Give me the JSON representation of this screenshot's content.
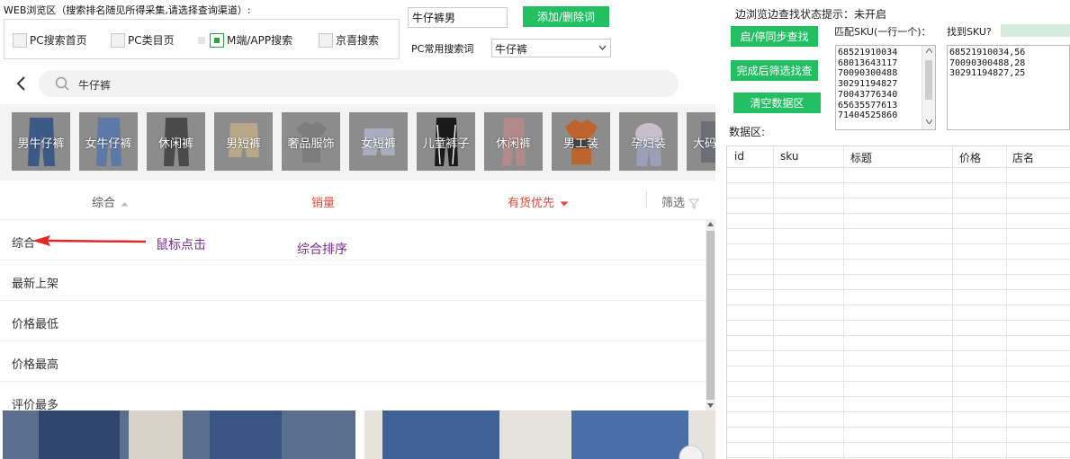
{
  "channel": {
    "title": "WEB浏览区（搜索排名随见所得采集,请选择查询渠道）:",
    "options": [
      {
        "label": "PC搜索首页",
        "checked": false
      },
      {
        "label": "PC类目页",
        "checked": false
      },
      {
        "label": "M端/APP搜索",
        "checked": true
      },
      {
        "label": "京喜搜索",
        "checked": false
      }
    ]
  },
  "keyword": {
    "value": "牛仔裤男",
    "add_button": "添加/删除词",
    "common_label": "PC常用搜索词",
    "common_selected": "牛仔裤"
  },
  "browser": {
    "search_text": "牛仔裤",
    "categories": [
      "男牛仔裤",
      "女牛仔裤",
      "休闲裤",
      "男短裤",
      "奢品服饰",
      "女短裤",
      "儿童裤子",
      "休闲裤",
      "男工装",
      "孕妇装",
      "大码"
    ],
    "sort_tabs": {
      "comprehensive": "综合",
      "sales": "销量",
      "in_stock": "有货优先",
      "filter": "筛选"
    },
    "sort_options": [
      "综合",
      "最新上架",
      "价格最低",
      "价格最高",
      "评价最多"
    ],
    "annotations": {
      "mouse_click": "鼠标点击",
      "sort_label": "综合排序"
    }
  },
  "right_panel": {
    "status_label": "边浏览边查找状态提示：未开启",
    "buttons": {
      "toggle_sync": "启/停同步查找",
      "filter_after": "完成后筛选找查",
      "clear_data": "清空数据区"
    },
    "match_sku_label": "匹配SKU(一行一个)：",
    "match_skus": [
      "68521910034",
      "68013643117",
      "70090300488",
      "30291194827",
      "70043776340",
      "65635577613",
      "71404525860"
    ],
    "found_label": "找到SKU?",
    "found_skus": [
      "68521910034,56",
      "70090300488,28",
      "30291194827,25"
    ],
    "data_area_label": "数据区:",
    "table_headers": [
      "id",
      "sku",
      "标题",
      "价格",
      "店名"
    ]
  },
  "colors": {
    "accent_green": "#22c063",
    "sales_red": "#e84a3a",
    "annotation_purple": "#7a2f8f",
    "arrow_red": "#e02a2a"
  }
}
